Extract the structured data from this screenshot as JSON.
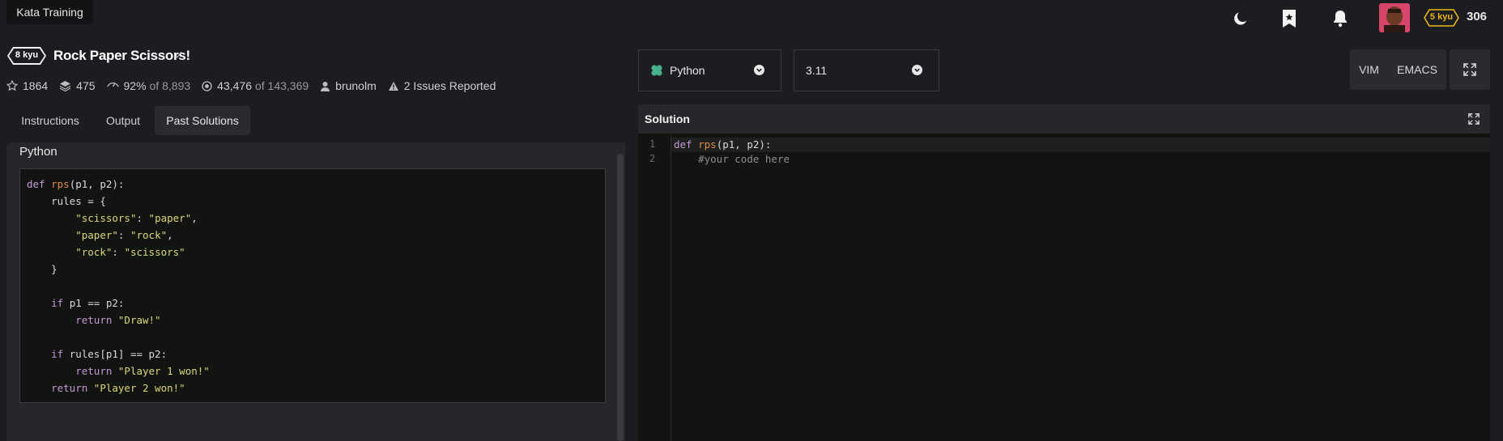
{
  "app": {
    "tab_label": "Kata Training",
    "honor": "306",
    "user_rank": "5 kyu",
    "accent_color": "#ecb613"
  },
  "kata": {
    "rank": "8 kyu",
    "title": "Rock Paper Scissors!",
    "check": "✓",
    "stats": {
      "stars": "1864",
      "collections": "475",
      "satisfaction_pct": "92%",
      "satisfaction_of": "of 8,893",
      "completions": "43,476",
      "completions_of": "of 143,369",
      "author": "brunolm",
      "issues": "2 Issues Reported"
    }
  },
  "left_tabs": {
    "instructions": "Instructions",
    "output": "Output",
    "past_solutions": "Past Solutions"
  },
  "past_solution": {
    "language": "Python"
  },
  "right": {
    "language_select": "Python",
    "version_select": "3.11",
    "vim": "VIM",
    "emacs": "EMACS",
    "solution_title": "Solution",
    "line_numbers": [
      "1",
      "2"
    ]
  }
}
